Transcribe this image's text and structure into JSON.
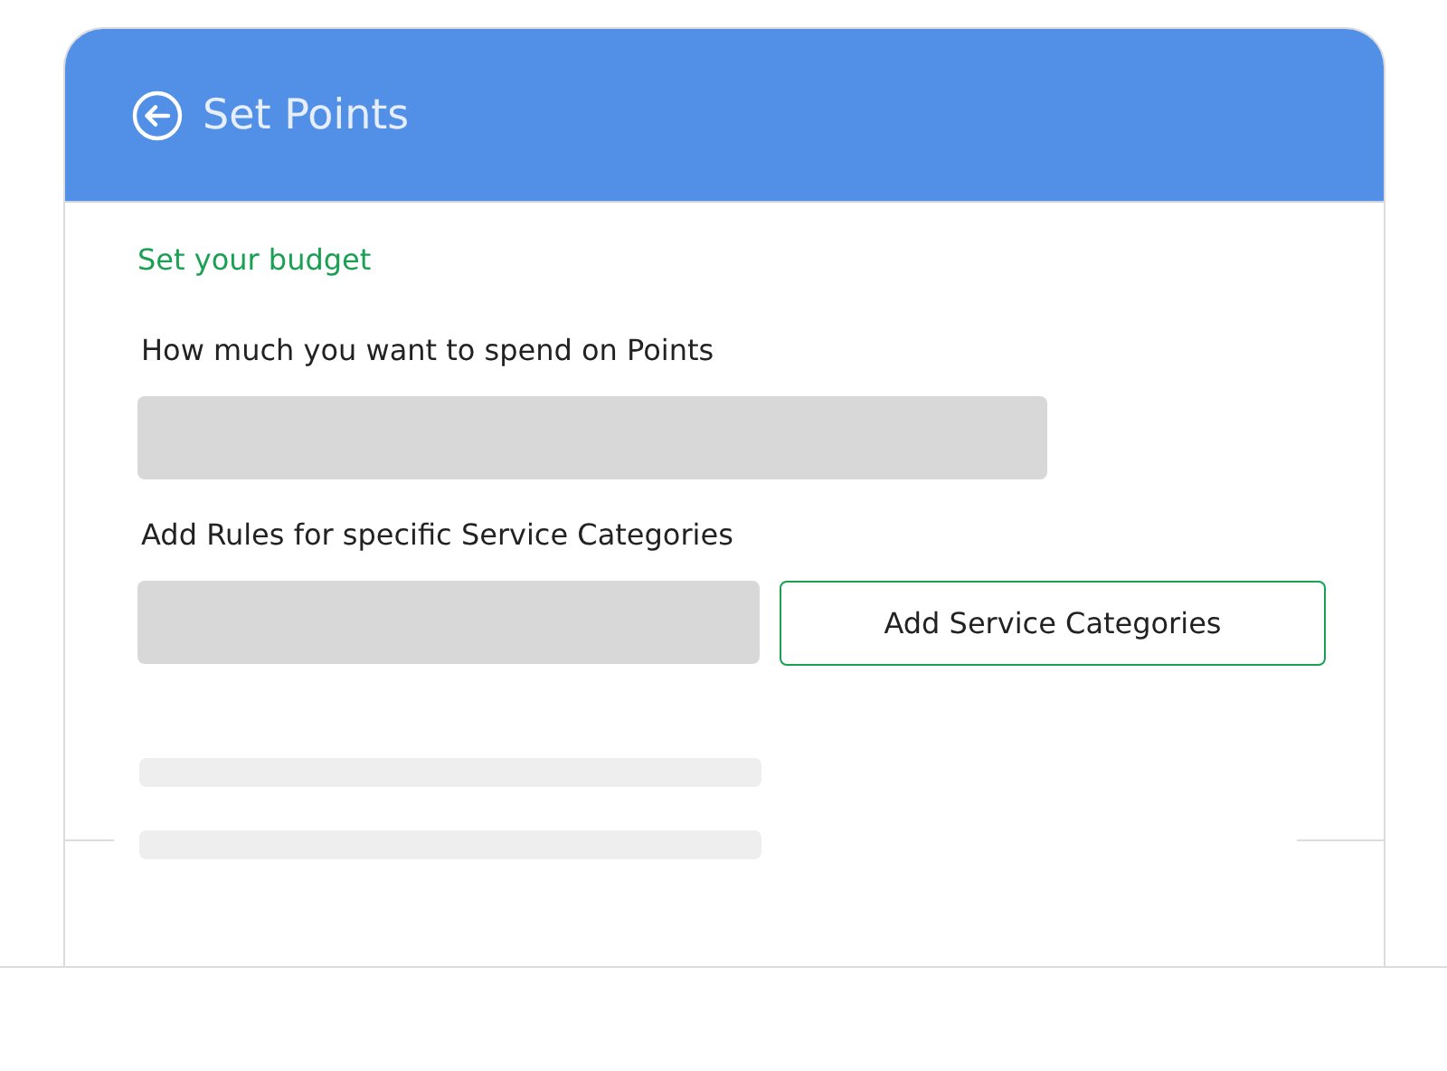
{
  "header": {
    "title": "Set Points"
  },
  "section_title": "Set your budget",
  "budget": {
    "label": "How much you want to spend on Points"
  },
  "rules": {
    "label": "Add Rules for specific Service Categories",
    "button": "Add Service Categories"
  }
}
